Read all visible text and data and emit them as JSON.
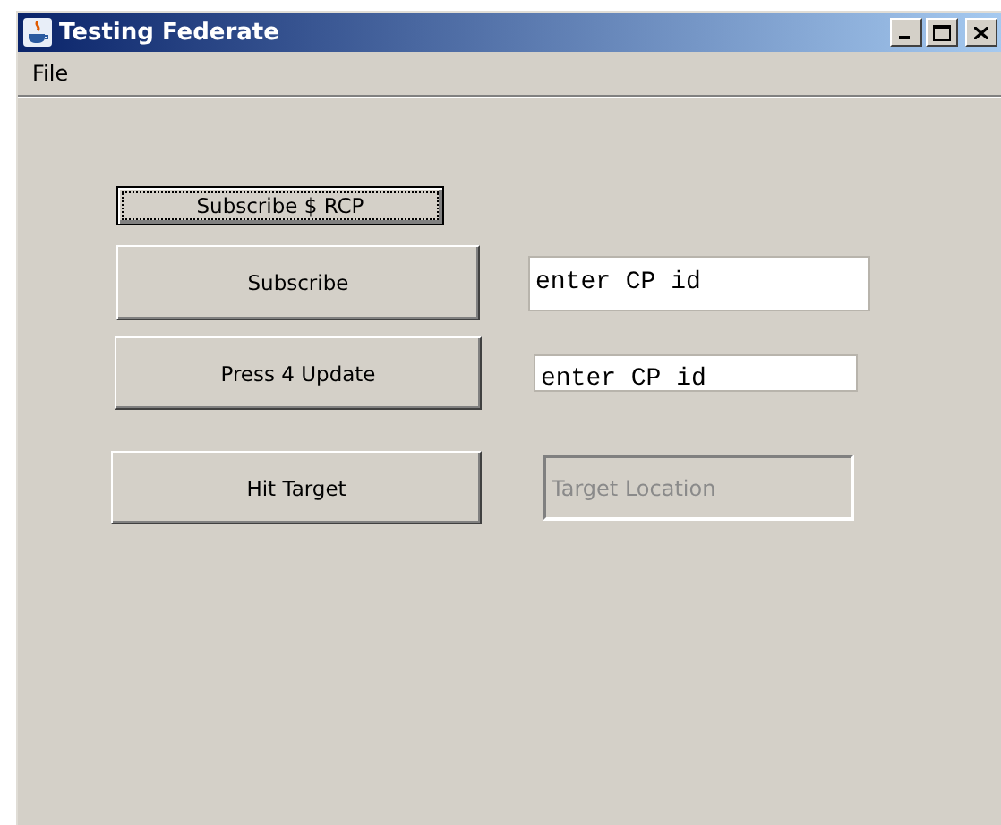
{
  "window": {
    "title": "Testing Federate"
  },
  "menu": [
    "File"
  ],
  "rows": [
    {
      "button": {
        "label": "Subscribe $ RCP",
        "focused": true
      }
    },
    {
      "button": {
        "label": "Subscribe",
        "focused": false
      },
      "field": {
        "value": "enter CP id",
        "disabled": false
      }
    },
    {
      "button": {
        "label": "Press 4 Update",
        "focused": false
      },
      "field": {
        "value": "enter CP id",
        "disabled": false
      }
    },
    {
      "button": {
        "label": "Hit Target",
        "focused": false
      },
      "field": {
        "value": "Target Location",
        "disabled": true
      }
    }
  ]
}
